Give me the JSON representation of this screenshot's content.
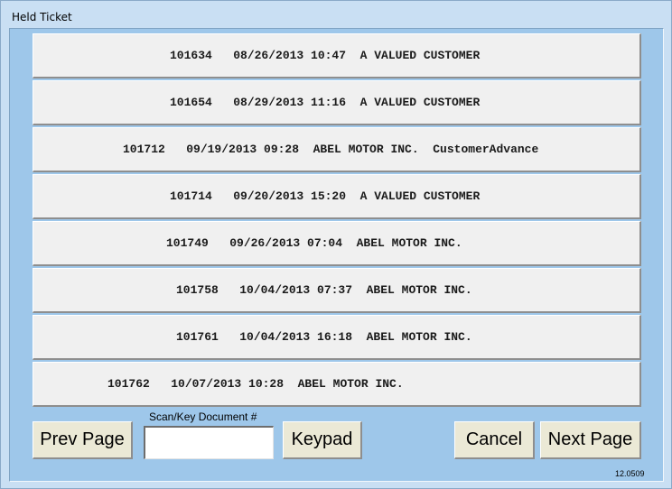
{
  "window": {
    "title": "Held Ticket"
  },
  "tickets": [
    {
      "text": "101634   08/26/2013 10:47  A VALUED CUSTOMER"
    },
    {
      "text": "101654   08/29/2013 11:16  A VALUED CUSTOMER"
    },
    {
      "text": "101712   09/19/2013 09:28  ABEL MOTOR INC.  CustomerAdvance"
    },
    {
      "text": "101714   09/20/2013 15:20  A VALUED CUSTOMER"
    },
    {
      "text": "101749   09/26/2013 07:04  ABEL MOTOR INC."
    },
    {
      "text": "101758   10/04/2013 07:37  ABEL MOTOR INC."
    },
    {
      "text": "101761   10/04/2013 16:18  ABEL MOTOR INC."
    },
    {
      "text": "101762   10/07/2013 10:28  ABEL MOTOR INC."
    }
  ],
  "controls": {
    "prev_page": "Prev Page",
    "scan_label": "Scan/Key Document #",
    "scan_value": "",
    "keypad": "Keypad",
    "cancel": "Cancel",
    "next_page": "Next Page"
  },
  "version": "12.0509"
}
